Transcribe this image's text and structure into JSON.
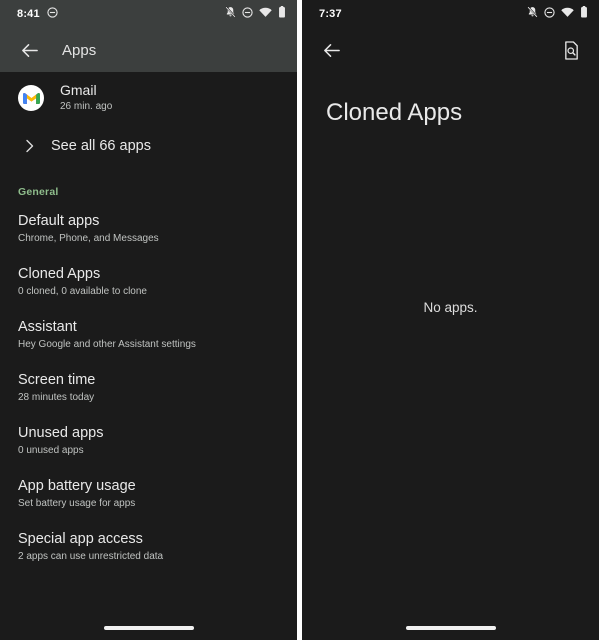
{
  "left_screen": {
    "status_bar": {
      "time": "8:41",
      "left_icons": [
        {
          "name": "dnd-circle-icon",
          "glyph": "circle-minus"
        }
      ],
      "right_icons": [
        {
          "name": "notifications-off-icon",
          "glyph": "bell-slash"
        },
        {
          "name": "do-not-disturb-icon",
          "glyph": "circle-minus"
        },
        {
          "name": "wifi-icon",
          "glyph": "wifi"
        },
        {
          "name": "battery-icon",
          "glyph": "battery-full"
        }
      ]
    },
    "toolbar": {
      "back_label": "Back",
      "title": "Apps"
    },
    "recent_app": {
      "icon_name": "gmail-icon",
      "name": "Gmail",
      "subtitle": "26 min. ago"
    },
    "see_all": {
      "label": "See all 66 apps",
      "icon_name": "chevron-right-icon"
    },
    "section_general": "General",
    "preferences": [
      {
        "title": "Default apps",
        "subtitle": "Chrome, Phone, and Messages"
      },
      {
        "title": "Cloned Apps",
        "subtitle": "0 cloned, 0 available to clone"
      },
      {
        "title": "Assistant",
        "subtitle": "Hey Google and other Assistant settings"
      },
      {
        "title": "Screen time",
        "subtitle": "28 minutes today"
      },
      {
        "title": "Unused apps",
        "subtitle": "0 unused apps"
      },
      {
        "title": "App battery usage",
        "subtitle": "Set battery usage for apps"
      },
      {
        "title": "Special app access",
        "subtitle": "2 apps can use unrestricted data"
      }
    ]
  },
  "right_screen": {
    "status_bar": {
      "time": "7:37",
      "right_icons": [
        {
          "name": "notifications-off-icon",
          "glyph": "bell-slash"
        },
        {
          "name": "do-not-disturb-icon",
          "glyph": "circle-minus"
        },
        {
          "name": "wifi-icon",
          "glyph": "wifi"
        },
        {
          "name": "battery-icon",
          "glyph": "battery-full"
        }
      ]
    },
    "toolbar": {
      "back_label": "Back",
      "action_icon_name": "document-search-icon"
    },
    "page_title": "Cloned Apps",
    "empty_state": "No apps."
  },
  "colors": {
    "background": "#1b1b1b",
    "toolbar_tint": "#3c3f3e",
    "accent_green": "#8fbd8c",
    "primary_text": "#e9e9e9",
    "secondary_text": "#c0c3c1"
  }
}
